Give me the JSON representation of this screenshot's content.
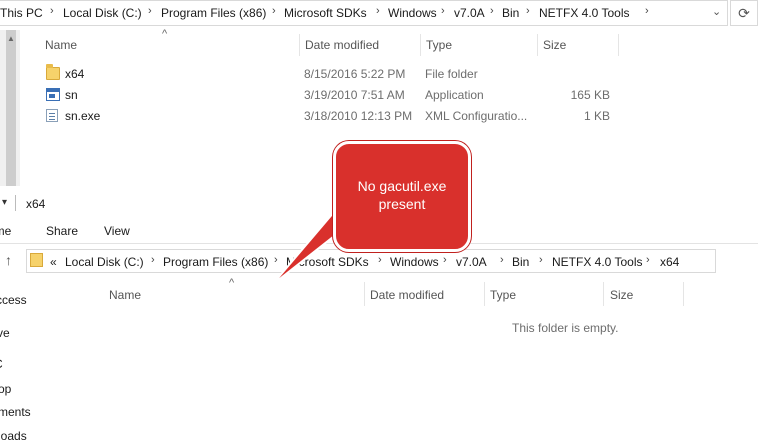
{
  "top_window": {
    "breadcrumbs": [
      "This PC",
      "Local Disk (C:)",
      "Program Files (x86)",
      "Microsoft SDKs",
      "Windows",
      "v7.0A",
      "Bin",
      "NETFX 4.0 Tools"
    ],
    "columns": {
      "name": "Name",
      "date": "Date modified",
      "type": "Type",
      "size": "Size"
    },
    "files": [
      {
        "name": "x64",
        "date": "8/15/2016 5:22 PM",
        "type": "File folder",
        "size": "",
        "icon": "folder-icon"
      },
      {
        "name": "sn",
        "date": "3/19/2010 7:51 AM",
        "type": "Application",
        "size": "165 KB",
        "icon": "application-icon"
      },
      {
        "name": "sn.exe",
        "date": "3/18/2010 12:13 PM",
        "type": "XML Configuratio...",
        "size": "1 KB",
        "icon": "xml-config-icon"
      }
    ]
  },
  "bottom_window": {
    "title": "x64",
    "ribbon_tabs": [
      "ome",
      "Share",
      "View"
    ],
    "breadcrumbs": [
      "«",
      "Local Disk (C:)",
      "Program Files (x86)",
      "Microsoft SDKs",
      "Windows",
      "v7.0A",
      "Bin",
      "NETFX 4.0 Tools",
      "x64"
    ],
    "nav_items": [
      "ccess",
      "ve",
      "C",
      "op",
      "ments",
      "loads"
    ],
    "columns": {
      "name": "Name",
      "date": "Date modified",
      "type": "Type",
      "size": "Size"
    },
    "empty_message": "This folder is empty."
  },
  "callout": {
    "line1": "No gacutil.exe",
    "line2": "present",
    "color": "#d9302c"
  }
}
